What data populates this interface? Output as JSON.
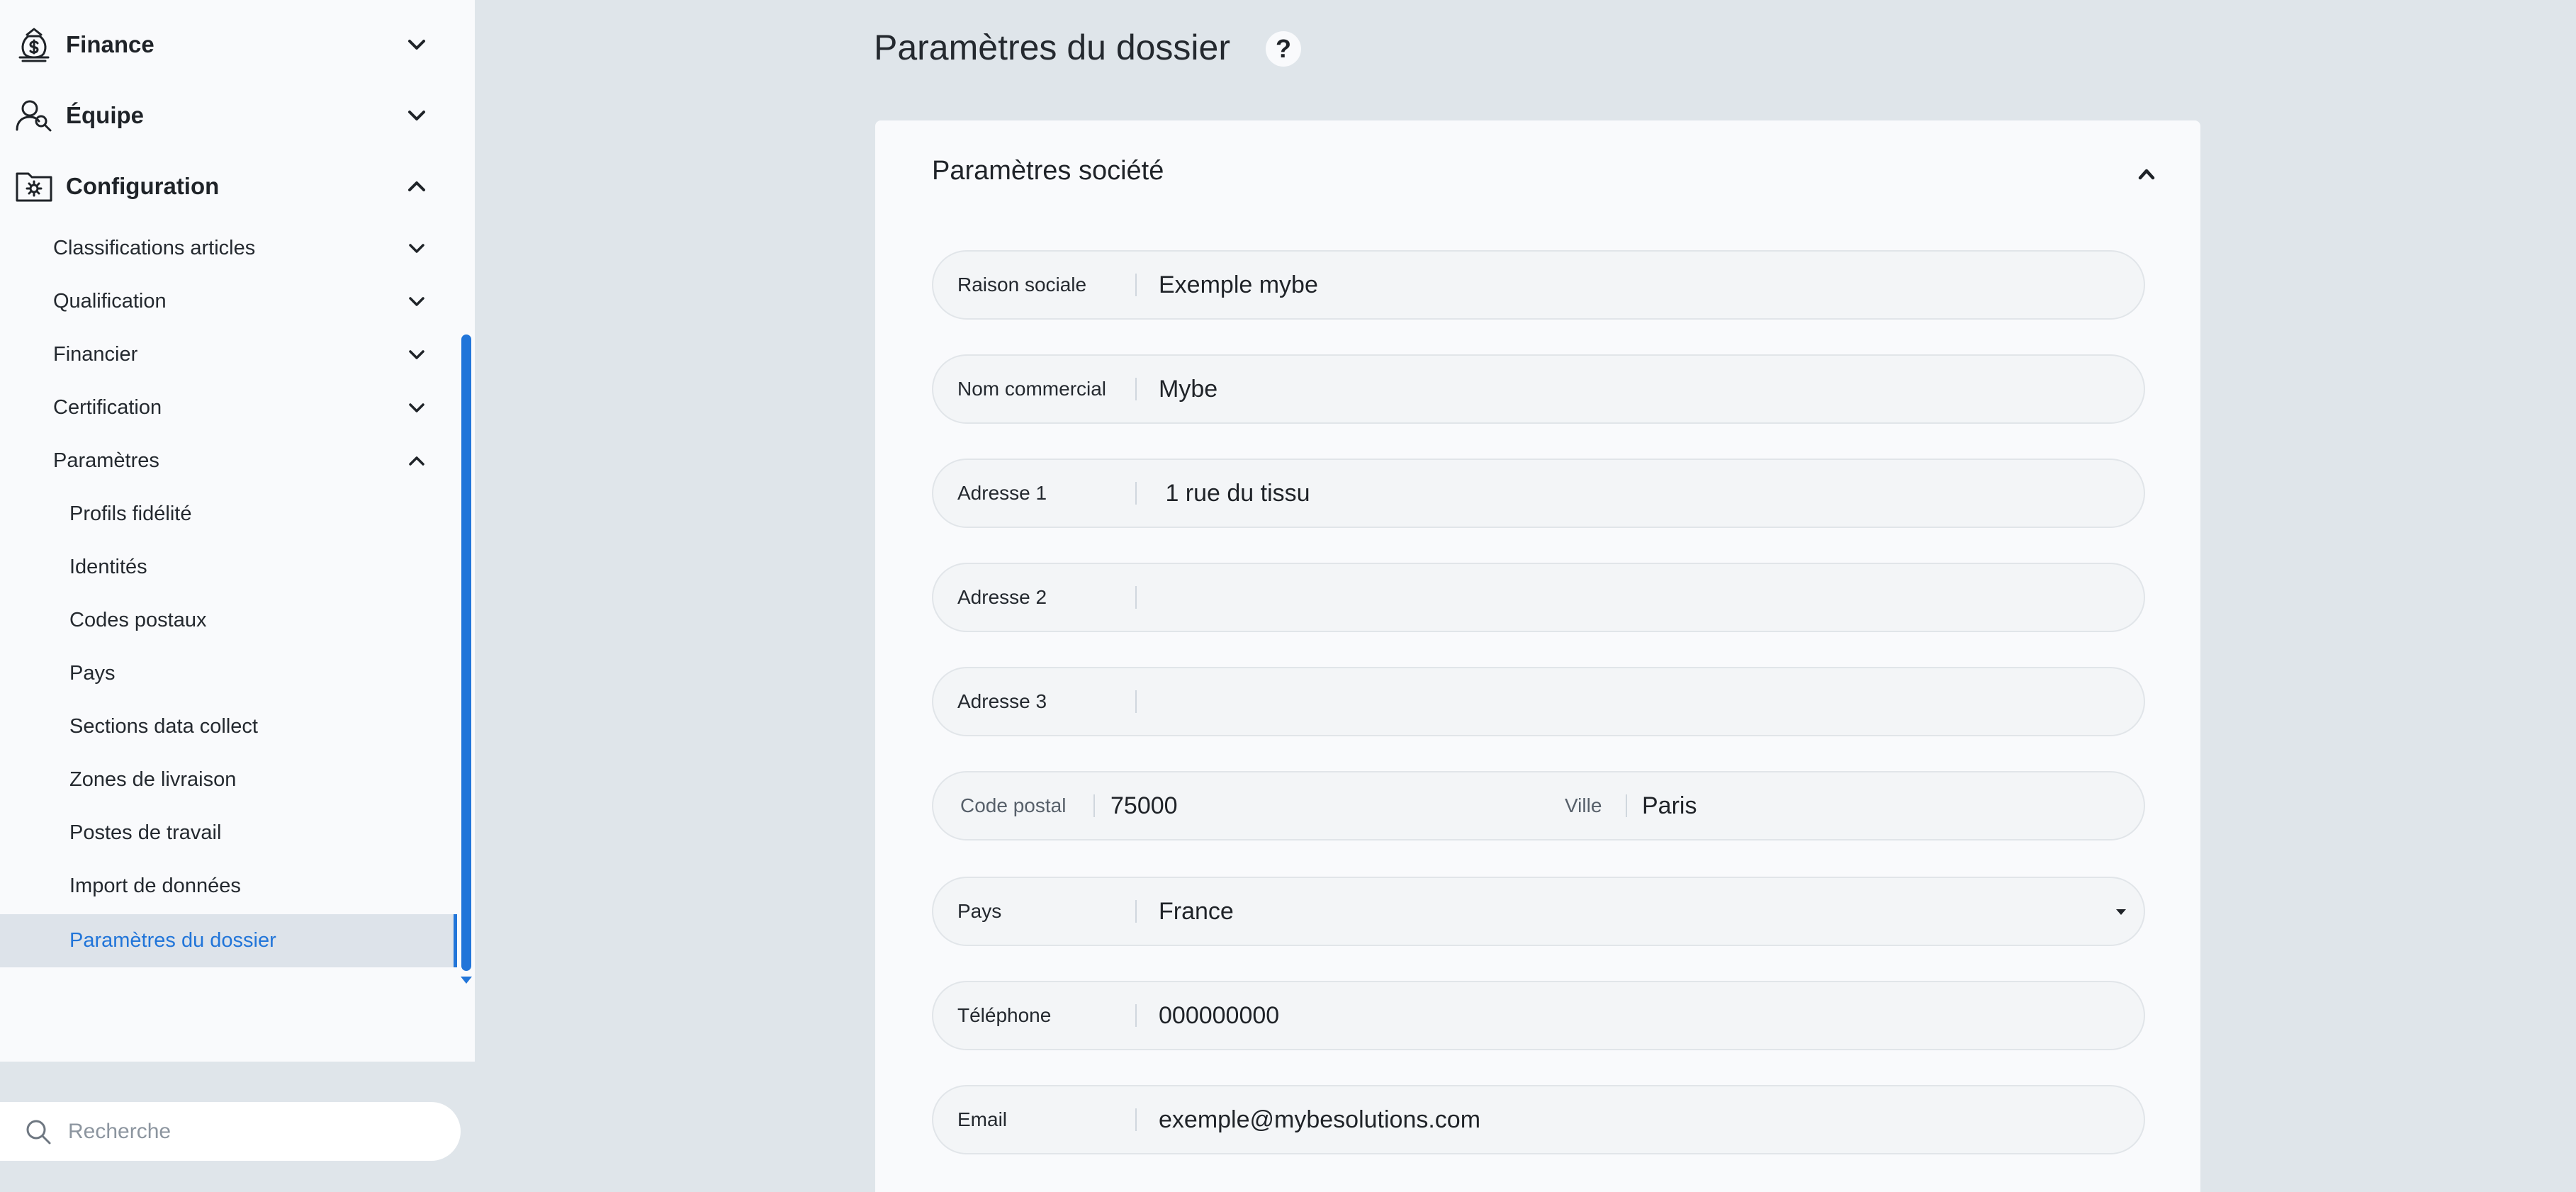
{
  "sidebar": {
    "top_items": [
      {
        "label": "Finance",
        "icon": "money-bag-icon",
        "expanded": false
      },
      {
        "label": "Équipe",
        "icon": "team-icon",
        "expanded": false
      },
      {
        "label": "Configuration",
        "icon": "settings-folder-icon",
        "expanded": true
      }
    ],
    "config_items": [
      {
        "label": "Classifications articles",
        "expanded": false
      },
      {
        "label": "Qualification",
        "expanded": false
      },
      {
        "label": "Financier",
        "expanded": false
      },
      {
        "label": "Certification",
        "expanded": false
      },
      {
        "label": "Paramètres",
        "expanded": true
      }
    ],
    "parametres_items": [
      {
        "label": "Profils fidélité"
      },
      {
        "label": "Identités"
      },
      {
        "label": "Codes postaux"
      },
      {
        "label": "Pays"
      },
      {
        "label": "Sections data collect"
      },
      {
        "label": "Zones de livraison"
      },
      {
        "label": "Postes de travail"
      },
      {
        "label": "Import de données"
      },
      {
        "label": "Paramètres du dossier",
        "active": true
      }
    ]
  },
  "search": {
    "placeholder": "Recherche",
    "icon": "search-icon"
  },
  "main": {
    "title": "Paramètres du dossier",
    "help_label": "?",
    "card": {
      "title": "Paramètres société",
      "fields": {
        "raison_sociale": {
          "label": "Raison sociale",
          "value": "Exemple mybe"
        },
        "nom_commercial": {
          "label": "Nom commercial",
          "value": "Mybe"
        },
        "adresse1": {
          "label": "Adresse 1",
          "value": " 1 rue du tissu"
        },
        "adresse2": {
          "label": "Adresse 2",
          "value": ""
        },
        "adresse3": {
          "label": "Adresse 3",
          "value": ""
        },
        "code_postal": {
          "label": "Code postal",
          "value": "75000"
        },
        "ville": {
          "label": "Ville",
          "value": "Paris"
        },
        "pays": {
          "label": "Pays",
          "value": "France"
        },
        "telephone": {
          "label": "Téléphone",
          "value": "000000000"
        },
        "email": {
          "label": "Email",
          "value": "exemple@mybesolutions.com"
        }
      }
    }
  },
  "colors": {
    "accent": "#2175d9",
    "background": "#dfe5ea",
    "panel": "#f9fafc",
    "field_bg": "#f3f5f7"
  }
}
